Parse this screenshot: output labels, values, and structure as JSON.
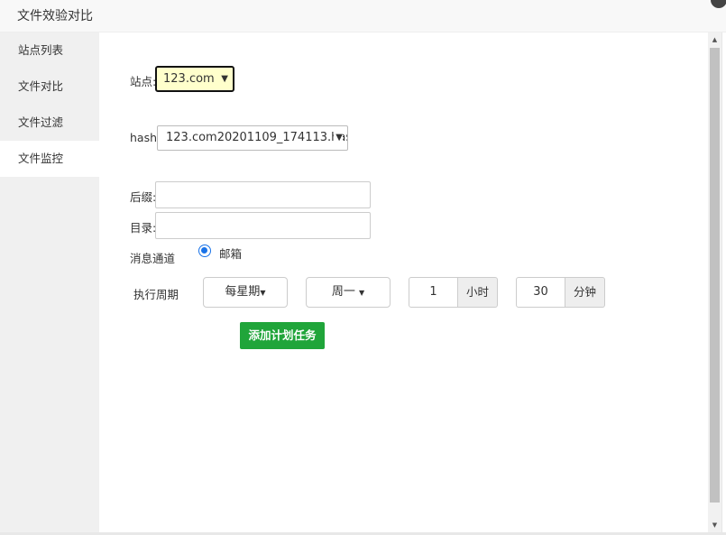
{
  "window": {
    "title": "文件效验对比"
  },
  "sidebar": {
    "items": [
      {
        "label": "站点列表"
      },
      {
        "label": "文件对比"
      },
      {
        "label": "文件过滤"
      },
      {
        "label": "文件监控",
        "active": true
      }
    ]
  },
  "form": {
    "site_label": "站点:",
    "site_value": "123.com",
    "hash_label": "hash:",
    "hash_value": "123.com20201109_174113.hash",
    "suffix_label": "后缀:",
    "suffix_value": "",
    "dir_label": "目录:",
    "dir_value": "",
    "channel_label": "消息通道",
    "channel_option": "邮箱",
    "period_label": "执行周期",
    "period_type": "每星期",
    "weekday": "周一",
    "hour_value": "1",
    "hour_unit": "小时",
    "minute_value": "30",
    "minute_unit": "分钟",
    "submit_label": "添加计划任务"
  },
  "colors": {
    "submit": "#20a53a",
    "radio": "#1a73e8",
    "site_select_bg": "#ffffcc"
  }
}
